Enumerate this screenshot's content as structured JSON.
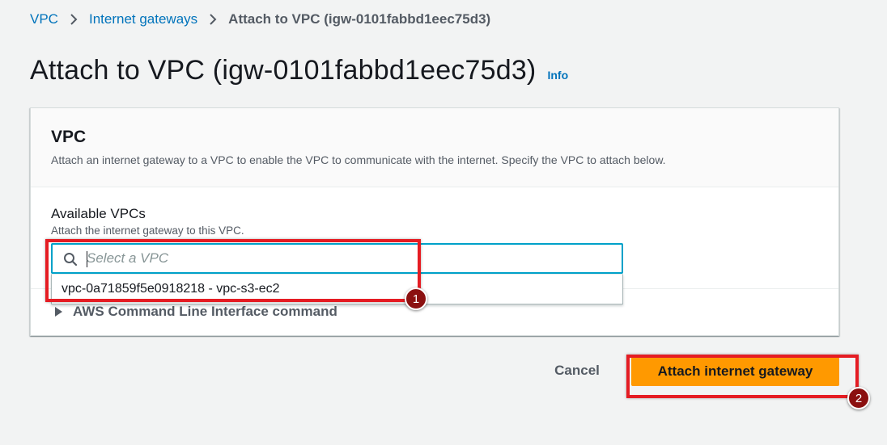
{
  "breadcrumb": {
    "items": [
      "VPC",
      "Internet gateways"
    ],
    "current": "Attach to VPC (igw-0101fabbd1eec75d3)"
  },
  "page": {
    "title": "Attach to VPC (igw-0101fabbd1eec75d3)",
    "info_label": "Info"
  },
  "panel": {
    "title": "VPC",
    "description": "Attach an internet gateway to a VPC to enable the VPC to communicate with the internet. Specify the VPC to attach below."
  },
  "field": {
    "label": "Available VPCs",
    "description": "Attach the internet gateway to this VPC.",
    "placeholder": "Select a VPC",
    "value": ""
  },
  "dropdown": {
    "options": [
      "vpc-0a71859f5e0918218 - vpc-s3-ec2"
    ]
  },
  "cli": {
    "label": "AWS Command Line Interface command"
  },
  "actions": {
    "cancel_label": "Cancel",
    "attach_label": "Attach internet gateway"
  },
  "annotations": {
    "step1": "1",
    "step2": "2"
  },
  "colors": {
    "link": "#0073bb",
    "primary_button": "#ff9900",
    "focus_border": "#00a1c9",
    "highlight": "#e51c23",
    "badge": "#8b1010"
  },
  "icons": [
    "chevron-right-icon",
    "search-icon",
    "caret-right-icon"
  ]
}
